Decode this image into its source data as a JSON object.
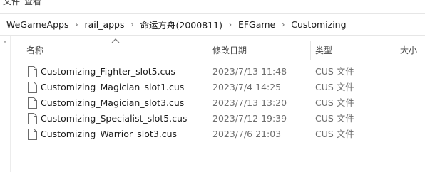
{
  "menu": {
    "item1": "文件",
    "item2": "查看"
  },
  "breadcrumb": [
    "WeGameApps",
    "rail_apps",
    "命运方舟(2000811)",
    "EFGame",
    "Customizing"
  ],
  "columns": {
    "name": "名称",
    "modified": "修改日期",
    "type": "类型",
    "size": "大小"
  },
  "files": [
    {
      "name": "Customizing_Fighter_slot5.cus",
      "modified": "2023/7/13 11:48",
      "type": "CUS 文件"
    },
    {
      "name": "Customizing_Magician_slot1.cus",
      "modified": "2023/7/4 14:25",
      "type": "CUS 文件"
    },
    {
      "name": "Customizing_Magician_slot3.cus",
      "modified": "2023/7/13 13:20",
      "type": "CUS 文件"
    },
    {
      "name": "Customizing_Specialist_slot5.cus",
      "modified": "2023/7/12 19:39",
      "type": "CUS 文件"
    },
    {
      "name": "Customizing_Warrior_slot3.cus",
      "modified": "2023/7/6 21:03",
      "type": "CUS 文件"
    }
  ],
  "icons": {
    "file": "document-icon",
    "separator": "chevron-right-icon",
    "sort": "sort-ascending-icon",
    "scroll": "chevron-up-icon"
  }
}
